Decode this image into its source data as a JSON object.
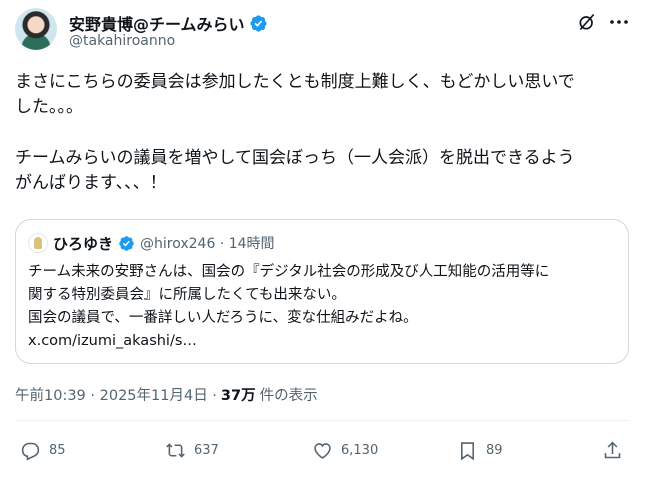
{
  "author": {
    "display_name": "安野貴博@チームみらい",
    "handle": "@takahiroanno"
  },
  "post": {
    "lines_1": [
      "まさにこちらの委員会は参加したくとも制度上難しく、もどかしい思いでした。。。"
    ],
    "line_1a": "まさにこちらの委員会は参加したくとも制度上難しく、もどかしい思いで",
    "line_1b": "した。。。",
    "line_2a": "チームみらいの議員を増やして国会ぼっち（一人会派）を脱出できるよう",
    "line_2b": "がんばります、、、！"
  },
  "quote": {
    "name": "ひろゆき",
    "meta": "@hirox246 · 14時間",
    "line_1": "チーム未来の安野さんは、国会の『デジタル社会の形成及び人工知能の活用等に",
    "line_2": "関する特別委員会』に所属したくても出来ない。",
    "line_3": "国会の議員で、一番詳しい人だろうに、変な仕組みだよね。",
    "line_4": "x.com/izumi_akashi/s…"
  },
  "timestamp": {
    "time_date": "午前10:39 · 2025年11月4日 ·",
    "views": "37万",
    "views_label": "件の表示"
  },
  "actions": {
    "replies": "85",
    "reposts": "637",
    "likes": "6,130",
    "bookmarks": "89"
  },
  "icons": {
    "verified": "verified-badge-icon",
    "grok": "grok-icon",
    "more": "more-icon",
    "reply": "reply-icon",
    "repost": "repost-icon",
    "like": "heart-icon",
    "bookmark": "bookmark-icon",
    "share": "share-icon"
  },
  "colors": {
    "verified": "#1d9bf0",
    "text": "#0f1419",
    "secondary": "#536471",
    "border": "#cfd9de"
  }
}
